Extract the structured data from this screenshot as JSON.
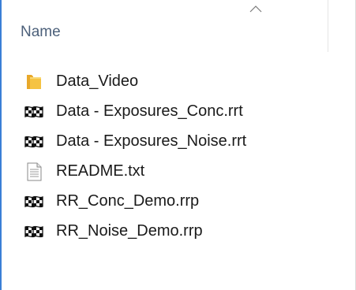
{
  "columns": {
    "name_label": "Name"
  },
  "files": [
    {
      "label": "Data_Video",
      "icon": "folder-icon"
    },
    {
      "label": "Data - Exposures_Conc.rrt",
      "icon": "checkered-flag-icon"
    },
    {
      "label": "Data - Exposures_Noise.rrt",
      "icon": "checkered-flag-icon"
    },
    {
      "label": "README.txt",
      "icon": "text-file-icon"
    },
    {
      "label": "RR_Conc_Demo.rrp",
      "icon": "checkered-flag-icon"
    },
    {
      "label": "RR_Noise_Demo.rrp",
      "icon": "checkered-flag-icon"
    }
  ],
  "colors": {
    "header_text": "#4c607a",
    "folder": "#f5c342",
    "accent_border": "#3a7fd6"
  }
}
